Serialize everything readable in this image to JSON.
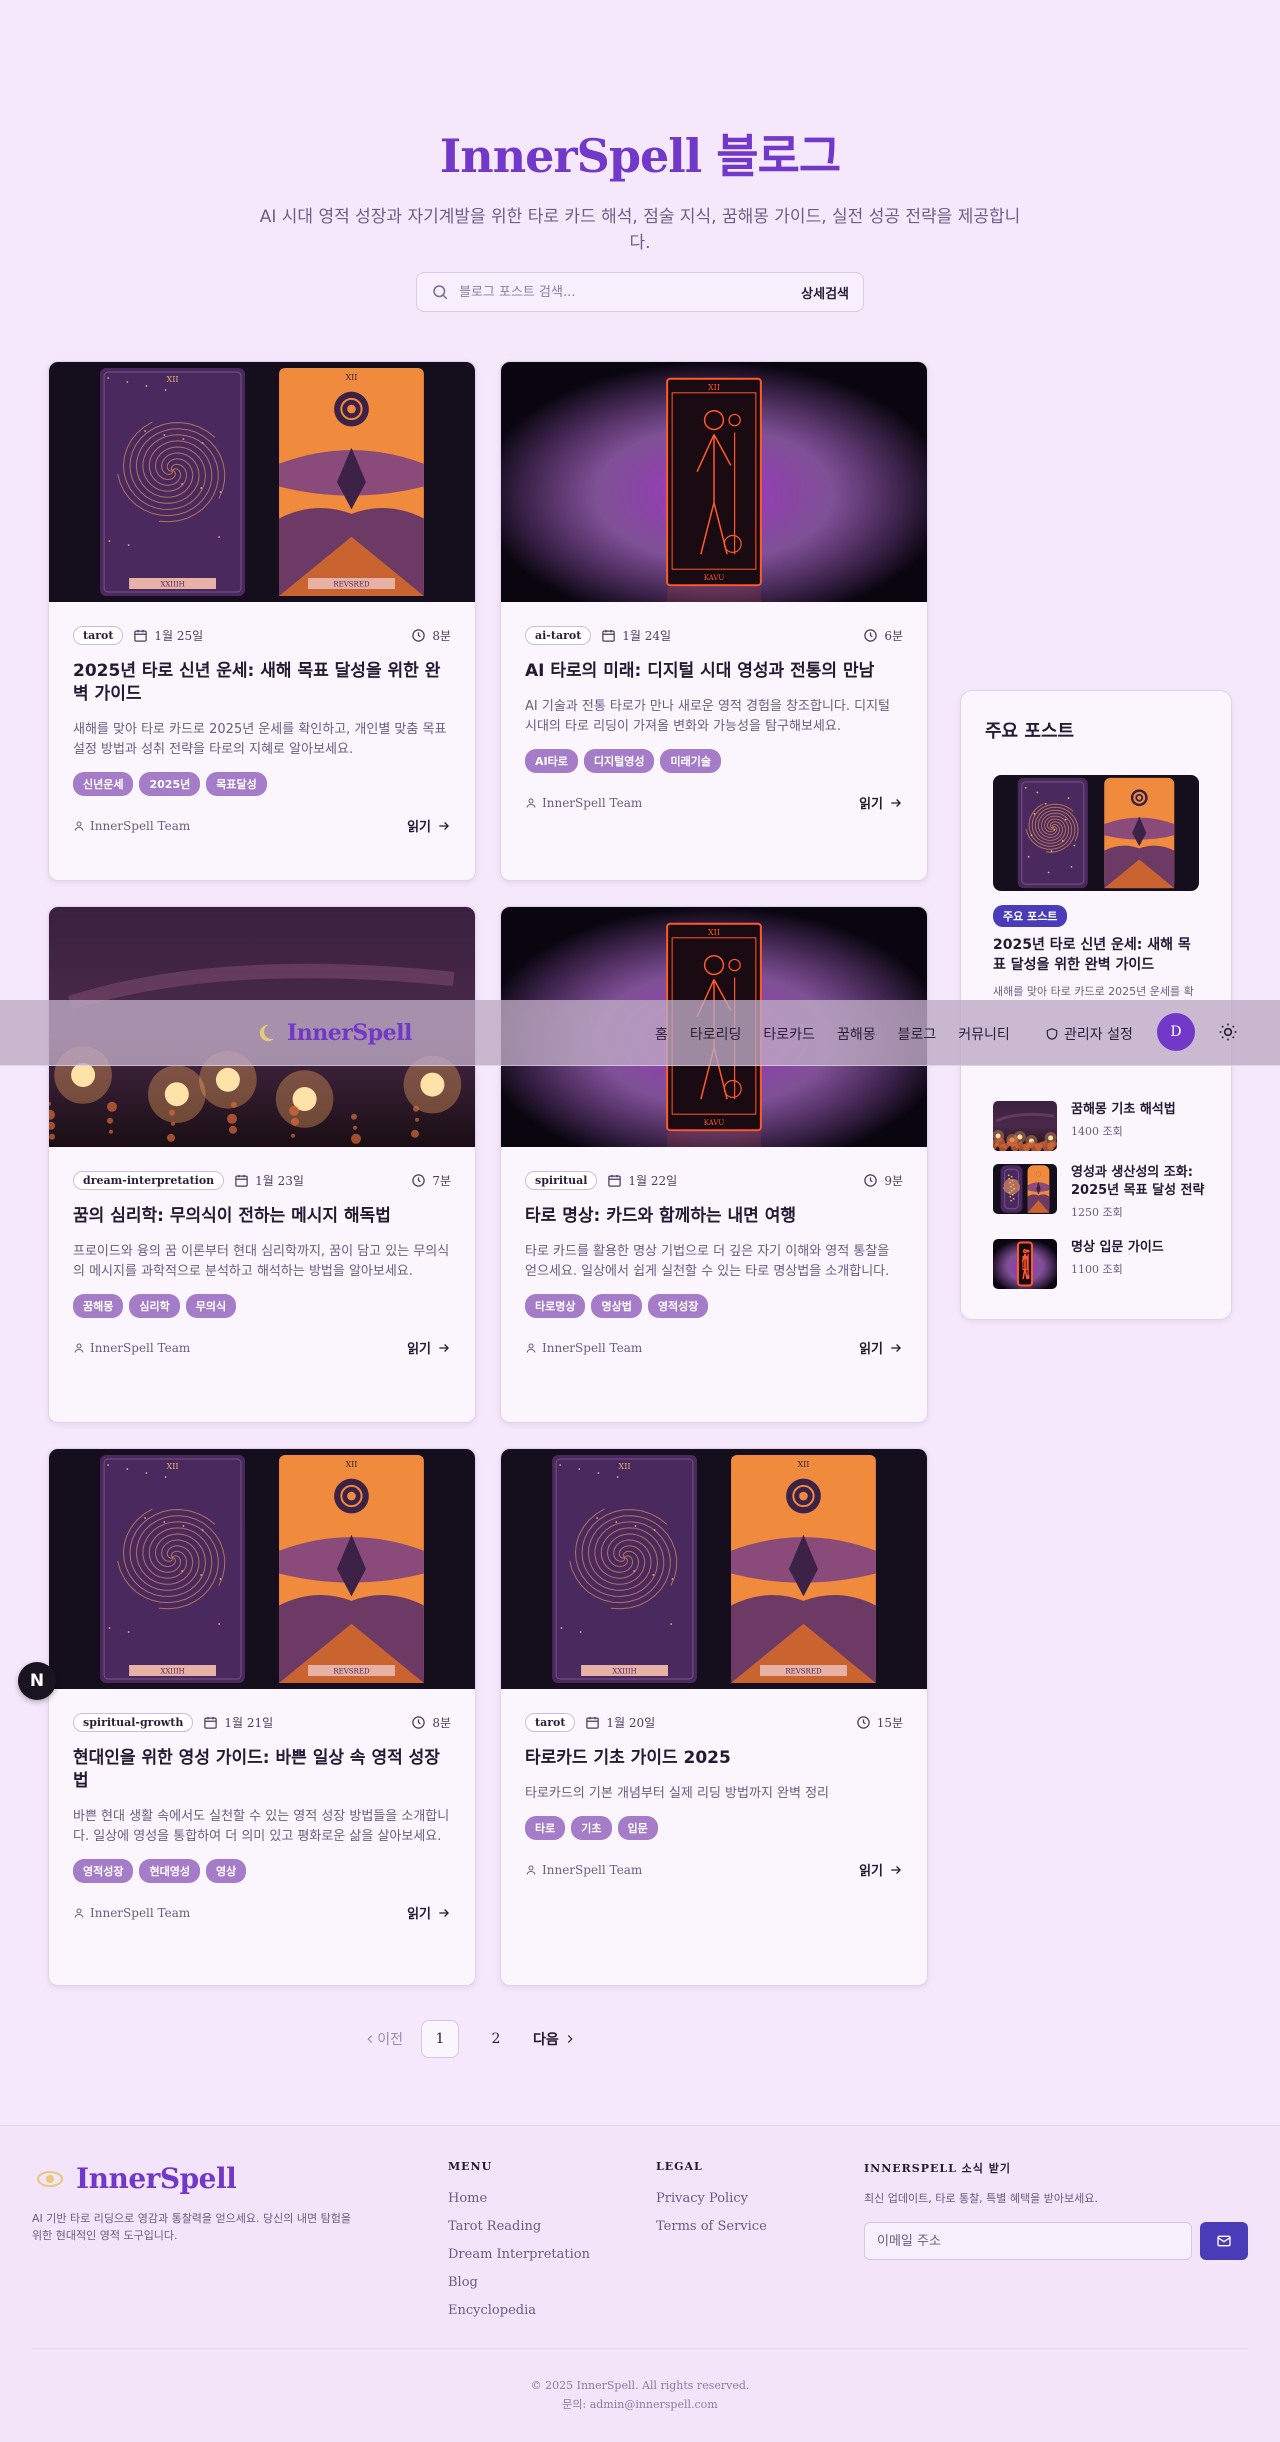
{
  "hero": {
    "title": "InnerSpell 블로그",
    "subtitle": "AI 시대 영적 성장과 자기계발을 위한 타로 카드 해석, 점술 지식, 꿈해몽 가이드, 실전 성공 전략을 제공합니다."
  },
  "search": {
    "placeholder": "블로그 포스트 검색...",
    "advanced_label": "상세검색"
  },
  "posts": [
    {
      "category": "tarot",
      "date": "1월 25일",
      "read_time": "8분",
      "title": "2025년 타로 신년 운세: 새해 목표 달성을 위한 완벽 가이드",
      "excerpt": "새해를 맞아 타로 카드로 2025년 운세를 확인하고, 개인별 맞춤 목표 설정 방법과 성취 전략을 타로의 지혜로 알아보세요.",
      "tags": [
        "신년운세",
        "2025년",
        "목표달성"
      ],
      "author": "InnerSpell Team",
      "read_label": "읽기",
      "image": "spiral-sun-cards",
      "card_labels": [
        "XII",
        "XII",
        "XXIIIH",
        "REVSRED"
      ]
    },
    {
      "category": "ai-tarot",
      "date": "1월 24일",
      "read_time": "6분",
      "title": "AI 타로의 미래: 디지털 시대 영성과 전통의 만남",
      "excerpt": "AI 기술과 전통 타로가 만나 새로운 영적 경험을 창조합니다. 디지털 시대의 타로 리딩이 가져올 변화와 가능성을 탐구해보세요.",
      "tags": [
        "AI타로",
        "디지털영성",
        "미래기술"
      ],
      "author": "InnerSpell Team",
      "read_label": "읽기",
      "image": "neon-figure-card",
      "card_labels": [
        "XII",
        "KAVU"
      ]
    },
    {
      "category": "dream-interpretation",
      "date": "1월 23일",
      "read_time": "7분",
      "title": "꿈의 심리학: 무의식이 전하는 메시지 해독법",
      "excerpt": "프로이드와 융의 꿈 이론부터 현대 심리학까지, 꿈이 담고 있는 무의식의 메시지를 과학적으로 분석하고 해석하는 방법을 알아보세요.",
      "tags": [
        "꿈해몽",
        "심리학",
        "무의식"
      ],
      "author": "InnerSpell Team",
      "read_label": "읽기",
      "image": "candles-night",
      "card_labels": []
    },
    {
      "category": "spiritual",
      "date": "1월 22일",
      "read_time": "9분",
      "title": "타로 명상: 카드와 함께하는 내면 여행",
      "excerpt": "타로 카드를 활용한 명상 기법으로 더 깊은 자기 이해와 영적 통찰을 얻으세요. 일상에서 쉽게 실천할 수 있는 타로 명상법을 소개합니다.",
      "tags": [
        "타로명상",
        "명상법",
        "영적성장"
      ],
      "author": "InnerSpell Team",
      "read_label": "읽기",
      "image": "neon-figure-card",
      "card_labels": [
        "XII",
        "KAVU"
      ]
    },
    {
      "category": "spiritual-growth",
      "date": "1월 21일",
      "read_time": "8분",
      "title": "현대인을 위한 영성 가이드: 바쁜 일상 속 영적 성장법",
      "excerpt": "바쁜 현대 생활 속에서도 실천할 수 있는 영적 성장 방법들을 소개합니다. 일상에 영성을 통합하여 더 의미 있고 평화로운 삶을 살아보세요.",
      "tags": [
        "영적성장",
        "현대영성",
        "영상"
      ],
      "author": "InnerSpell Team",
      "read_label": "읽기",
      "image": "spiral-sun-cards",
      "card_labels": [
        "XII",
        "XII",
        "XXIIIH",
        "REVSRED"
      ]
    },
    {
      "category": "tarot",
      "date": "1월 20일",
      "read_time": "15분",
      "title": "타로카드 기초 가이드 2025",
      "excerpt": "타로카드의 기본 개념부터 실제 리딩 방법까지 완벽 정리",
      "tags": [
        "타로",
        "기초",
        "입문"
      ],
      "author": "InnerSpell Team",
      "read_label": "읽기",
      "image": "spiral-sun-cards",
      "card_labels": [
        "XII",
        "XII",
        "XXIIIH",
        "REVSRED"
      ]
    }
  ],
  "sidebar": {
    "title": "주요 포스트",
    "featured": {
      "badge": "주요 포스트",
      "title": "2025년 타로 신년 운세: 새해 목표 달성을 위한 완벽 가이드",
      "excerpt": "새해를 맞아 타로 카드로 2025년 운세를 확"
    },
    "popular": [
      {
        "title": "꿈해몽 기초 해석법",
        "views": "1400 조회",
        "image": "candles-night"
      },
      {
        "title": "영성과 생산성의 조화: 2025년 목표 달성 전략",
        "views": "1250 조회",
        "image": "spiral-sun-cards"
      },
      {
        "title": "명상 입문 가이드",
        "views": "1100 조회",
        "image": "neon-figure-card"
      }
    ]
  },
  "nav": {
    "brand": "InnerSpell",
    "links": [
      "홈",
      "타로리딩",
      "타로카드",
      "꿈해몽",
      "블로그",
      "커뮤니티"
    ],
    "admin": "관리자 설정",
    "avatar_initial": "D"
  },
  "floating_badge": "N",
  "pagination": {
    "prev": "이전",
    "pages": [
      "1",
      "2"
    ],
    "current": "1",
    "next": "다음"
  },
  "footer": {
    "brand": "InnerSpell",
    "description": "AI 기반 타로 리딩으로 영감과 통찰력을 얻으세요. 당신의 내면 탐험을 위한 현대적인 영적 도구입니다.",
    "menu_title": "MENU",
    "menu": [
      "Home",
      "Tarot Reading",
      "Dream Interpretation",
      "Blog",
      "Encyclopedia"
    ],
    "legal_title": "LEGAL",
    "legal": [
      "Privacy Policy",
      "Terms of Service"
    ],
    "newsletter_title": "INNERSPELL 소식 받기",
    "newsletter_desc": "최신 업데이트, 타로 통찰, 특별 혜택을 받아보세요.",
    "email_placeholder": "이메일 주소",
    "copyright": "© 2025 InnerSpell. All rights reserved.",
    "contact": "문의: admin@innerspell.com"
  },
  "colors": {
    "brand": "#7238c8",
    "accent": "#4a3bb8",
    "tag": "#a57cc8",
    "background": "#f5e8fb"
  }
}
